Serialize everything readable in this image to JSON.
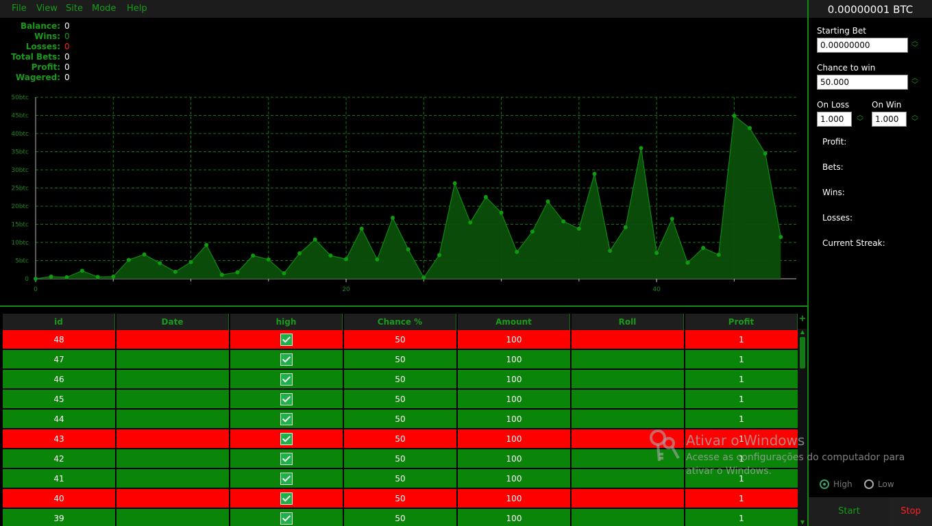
{
  "menu": [
    "File",
    "View",
    "Site",
    "Mode",
    "Help"
  ],
  "stats": [
    {
      "label": "Balance:",
      "value": "0"
    },
    {
      "label": "Wins:",
      "value": "0"
    },
    {
      "label": "Losses:",
      "value": "0"
    },
    {
      "label": "Total Bets:",
      "value": "0"
    },
    {
      "label": "Profit:",
      "value": "0"
    },
    {
      "label": "Wagered:",
      "value": "0"
    }
  ],
  "colors": {
    "accent": "#1a9a1a",
    "win_row": "#0a850a",
    "loss_row": "#ff0000",
    "loss_text": "#ff2020"
  },
  "chart_data": {
    "type": "area",
    "title": "",
    "xlabel": "",
    "ylabel": "",
    "x_ticks": [
      "0",
      "20",
      "40"
    ],
    "y_ticks": [
      "0",
      "5btc",
      "10btc",
      "15btc",
      "20btc",
      "25btc",
      "30btc",
      "35btc",
      "40btc",
      "45btc",
      "50btc"
    ],
    "xlim": [
      0,
      49
    ],
    "ylim": [
      0,
      50
    ],
    "grid": true,
    "series": [
      {
        "values": [
          0,
          0.6,
          0.4,
          2.2,
          0.5,
          0.6,
          5.2,
          6.7,
          4.3,
          1.9,
          4.6,
          9.3,
          1.1,
          1.8,
          6.4,
          5.3,
          1.5,
          7.0,
          10.8,
          6.4,
          5.4,
          13.8,
          5.3,
          16.8,
          8.1,
          0.3,
          6.5,
          26.3,
          15.5,
          22.5,
          18.2,
          7.4,
          13.0,
          21.3,
          15.8,
          13.8,
          28.9,
          7.7,
          14.2,
          36.0,
          7.1,
          16.5,
          4.4,
          8.5,
          6.6,
          44.9,
          41.5,
          34.5,
          11.5
        ]
      }
    ]
  },
  "table": {
    "add_symbol": "+",
    "headers": [
      "id",
      "Date",
      "high",
      "Chance %",
      "Amount",
      "Roll",
      "Profit"
    ],
    "rows": [
      {
        "id": "48",
        "date": "",
        "chance": "50",
        "amount": "100",
        "roll": "",
        "profit": "1",
        "result": "loss"
      },
      {
        "id": "47",
        "date": "",
        "chance": "50",
        "amount": "100",
        "roll": "",
        "profit": "1",
        "result": "win"
      },
      {
        "id": "46",
        "date": "",
        "chance": "50",
        "amount": "100",
        "roll": "",
        "profit": "1",
        "result": "win"
      },
      {
        "id": "45",
        "date": "",
        "chance": "50",
        "amount": "100",
        "roll": "",
        "profit": "1",
        "result": "win"
      },
      {
        "id": "44",
        "date": "",
        "chance": "50",
        "amount": "100",
        "roll": "",
        "profit": "1",
        "result": "win"
      },
      {
        "id": "43",
        "date": "",
        "chance": "50",
        "amount": "100",
        "roll": "",
        "profit": "1",
        "result": "loss"
      },
      {
        "id": "42",
        "date": "",
        "chance": "50",
        "amount": "100",
        "roll": "",
        "profit": "1",
        "result": "win"
      },
      {
        "id": "41",
        "date": "",
        "chance": "50",
        "amount": "100",
        "roll": "",
        "profit": "1",
        "result": "win"
      },
      {
        "id": "40",
        "date": "",
        "chance": "50",
        "amount": "100",
        "roll": "",
        "profit": "1",
        "result": "loss"
      },
      {
        "id": "39",
        "date": "",
        "chance": "50",
        "amount": "100",
        "roll": "",
        "profit": "1",
        "result": "win"
      }
    ]
  },
  "sidebar": {
    "balance": "0.00000001 BTC",
    "starting_bet_label": "Starting Bet",
    "starting_bet_value": "0.00000000",
    "chance_label": "Chance to win",
    "chance_value": "50.000",
    "on_loss_label": "On Loss",
    "on_loss_value": "1.000",
    "on_win_label": "On Win",
    "on_win_value": "1.000",
    "profit_label": "Profit:",
    "bets_label": "Bets:",
    "wins_label": "Wins:",
    "losses_label": "Losses:",
    "streak_label": "Current Streak:",
    "high_label": "High",
    "low_label": "Low",
    "selected_direction": "High",
    "start_label": "Start",
    "stop_label": "Stop"
  },
  "watermark": {
    "title": "Ativar o Windows",
    "line1": "Acesse as configurações do computador para",
    "line2": "ativar o Windows."
  }
}
